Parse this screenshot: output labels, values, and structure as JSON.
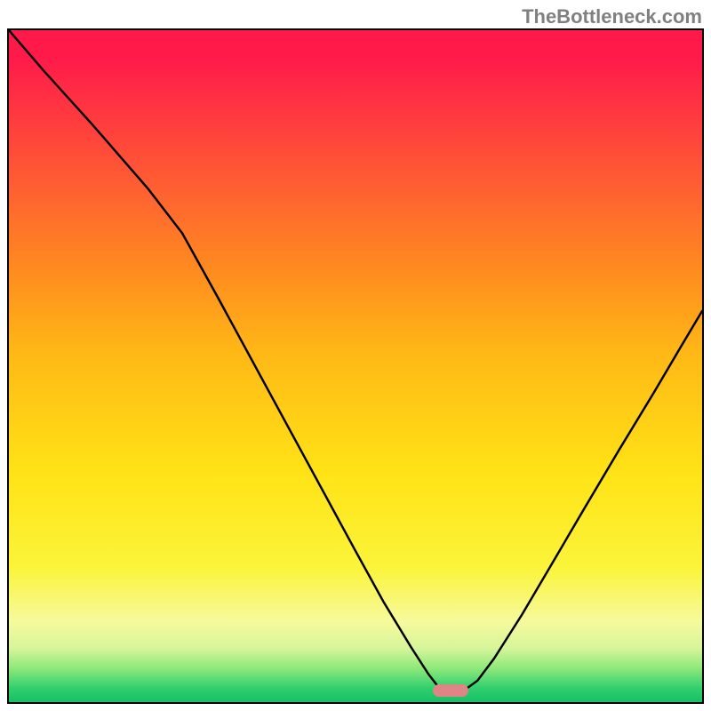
{
  "watermark": {
    "text": "TheBottleneck.com"
  },
  "chart_data": {
    "type": "line",
    "title": "",
    "xlabel": "",
    "ylabel": "",
    "xlim": [
      0,
      1000
    ],
    "ylim": [
      0,
      1000
    ],
    "grid": false,
    "background": "rainbow-vertical",
    "marker": {
      "x_frac": 0.637,
      "y_frac": 0.983,
      "color": "#e08585"
    },
    "series": [
      {
        "name": "bottleneck-curve",
        "type": "line",
        "color": "#000000",
        "points_xy_frac": [
          [
            0.0,
            0.0
          ],
          [
            0.05,
            0.06
          ],
          [
            0.12,
            0.14
          ],
          [
            0.2,
            0.235
          ],
          [
            0.25,
            0.302
          ],
          [
            0.3,
            0.395
          ],
          [
            0.35,
            0.49
          ],
          [
            0.4,
            0.585
          ],
          [
            0.45,
            0.68
          ],
          [
            0.5,
            0.775
          ],
          [
            0.54,
            0.85
          ],
          [
            0.58,
            0.918
          ],
          [
            0.605,
            0.958
          ],
          [
            0.62,
            0.978
          ],
          [
            0.64,
            0.985
          ],
          [
            0.66,
            0.98
          ],
          [
            0.676,
            0.968
          ],
          [
            0.7,
            0.935
          ],
          [
            0.74,
            0.87
          ],
          [
            0.78,
            0.8
          ],
          [
            0.83,
            0.712
          ],
          [
            0.88,
            0.625
          ],
          [
            0.93,
            0.54
          ],
          [
            0.97,
            0.47
          ],
          [
            1.0,
            0.418
          ]
        ]
      }
    ]
  }
}
